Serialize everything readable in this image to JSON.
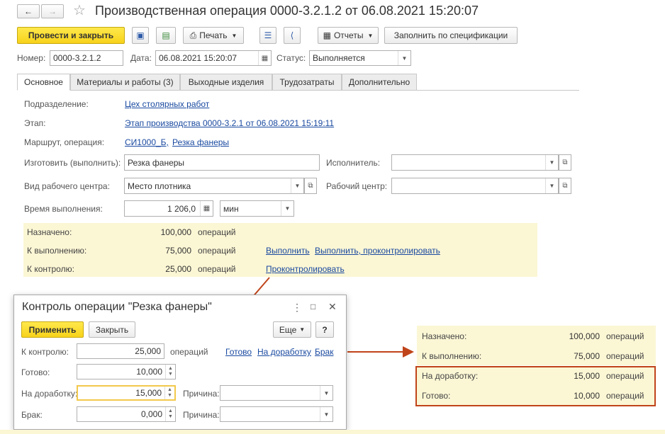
{
  "window": {
    "title": "Производственная операция 0000-3.2.1.2 от 06.08.2021 15:20:07"
  },
  "toolbar": {
    "post_close": "Провести и закрыть",
    "print": "Печать",
    "reports": "Отчеты",
    "fill_spec": "Заполнить по спецификации"
  },
  "header": {
    "number_label": "Номер:",
    "number_value": "0000-3.2.1.2",
    "date_label": "Дата:",
    "date_value": "06.08.2021 15:20:07",
    "status_label": "Статус:",
    "status_value": "Выполняется"
  },
  "tabs": [
    {
      "label": "Основное"
    },
    {
      "label": "Материалы и работы (3)"
    },
    {
      "label": "Выходные изделия"
    },
    {
      "label": "Трудозатраты"
    },
    {
      "label": "Дополнительно"
    }
  ],
  "main": {
    "division_label": "Подразделение:",
    "division_value": "Цех столярных работ",
    "stage_label": "Этап:",
    "stage_value": "Этап производства 0000-3.2.1 от 06.08.2021 15:19:11",
    "route_label": "Маршрут, операция:",
    "route_value1": "СИ1000_Б,",
    "route_value2": "Резка фанеры",
    "make_label": "Изготовить (выполнить):",
    "make_value": "Резка фанеры",
    "executor_label": "Исполнитель:",
    "executor_value": "",
    "wc_type_label": "Вид рабочего центра:",
    "wc_type_value": "Место плотника",
    "wc_label": "Рабочий центр:",
    "wc_value": "",
    "time_label": "Время выполнения:",
    "time_value": "1 206,0",
    "time_unit": "мин"
  },
  "summary": {
    "assigned_label": "Назначено:",
    "assigned_value": "100,000",
    "todo_label": "К выполнению:",
    "todo_value": "75,000",
    "control_label": "К контролю:",
    "control_value": "25,000",
    "unit": "операций",
    "link_execute": "Выполнить",
    "link_execute_control": "Выполнить, проконтролировать",
    "link_control": "Проконтролировать"
  },
  "dialog": {
    "title": "Контроль операции \"Резка фанеры\"",
    "apply": "Применить",
    "close": "Закрыть",
    "more": "Еще",
    "help": "?",
    "to_control_label": "К контролю:",
    "to_control_value": "25,000",
    "to_control_unit": "операций",
    "link_done": "Готово",
    "link_rework": "На доработку",
    "link_defect": "Брак",
    "done_label": "Готово:",
    "done_value": "10,000",
    "rework_label": "На доработку:",
    "rework_value": "15,000",
    "defect_label": "Брак:",
    "defect_value": "0,000",
    "reason_label": "Причина:"
  },
  "result": {
    "assigned_label": "Назначено:",
    "assigned_value": "100,000",
    "todo_label": "К выполнению:",
    "todo_value": "75,000",
    "rework_label": "На доработку:",
    "rework_value": "15,000",
    "done_label": "Готово:",
    "done_value": "10,000",
    "unit": "операций"
  },
  "colors": {
    "accent": "#f7d21a",
    "panel": "#fbf6d4",
    "highlight": "#c0441a",
    "link": "#1a4aa0"
  }
}
